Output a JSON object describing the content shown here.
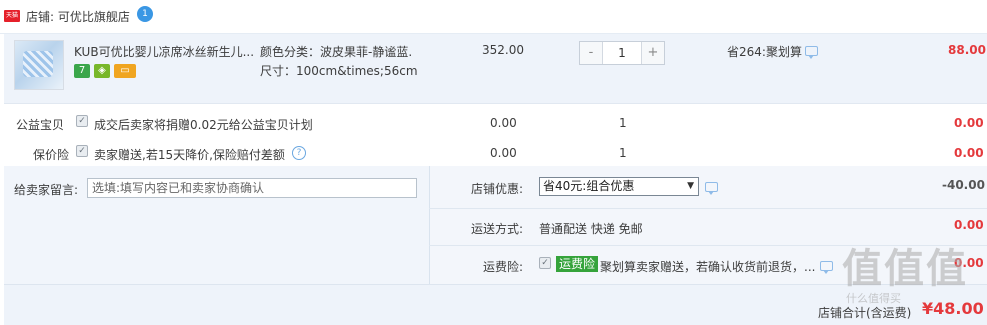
{
  "shop": {
    "badge": "天猫",
    "label": "店铺: 可优比旗舰店",
    "wangwang_count": "1"
  },
  "item": {
    "title": "KUB可优比婴儿凉席冰丝新生儿...",
    "sku_color": "颜色分类：波皮果菲-静谧蓝.",
    "sku_size": "尺寸：100cm&times;56cm",
    "unit_price": "352.00",
    "quantity": "1",
    "qty_minus": "-",
    "qty_plus": "+",
    "promo": "省264:聚划算",
    "subtotal": "88.00"
  },
  "charity": {
    "label": "公益宝贝",
    "desc": "成交后卖家将捐赠0.02元给公益宝贝计划",
    "price": "0.00",
    "qty": "1",
    "subtotal": "0.00"
  },
  "price_protect": {
    "label": "保价险",
    "desc": "卖家赠送,若15天降价,保险赔付差额",
    "price": "0.00",
    "qty": "1",
    "subtotal": "0.00"
  },
  "message": {
    "label": "给卖家留言:",
    "placeholder": "选填:填写内容已和卖家协商确认"
  },
  "discount": {
    "label": "店铺优惠:",
    "selected": "省40元:组合优惠",
    "amount": "-40.00"
  },
  "shipping": {
    "label": "运送方式:",
    "value": "普通配送 快递 免邮",
    "amount": "0.00"
  },
  "freight_insurance": {
    "label": "运费险:",
    "tag": "运费险",
    "desc": "聚划算卖家赠送，若确认收货前退货，...",
    "amount": "0.00"
  },
  "total": {
    "label": "店铺合计(含运费)",
    "amount": "¥48.00"
  },
  "watermark": {
    "text": "值值值",
    "sub": "什么值得买"
  },
  "colors": {
    "accent_red": "#e4393c",
    "tmall_red": "#e5202a",
    "row_bg": "#eef3fa",
    "green": "#35a33b"
  }
}
